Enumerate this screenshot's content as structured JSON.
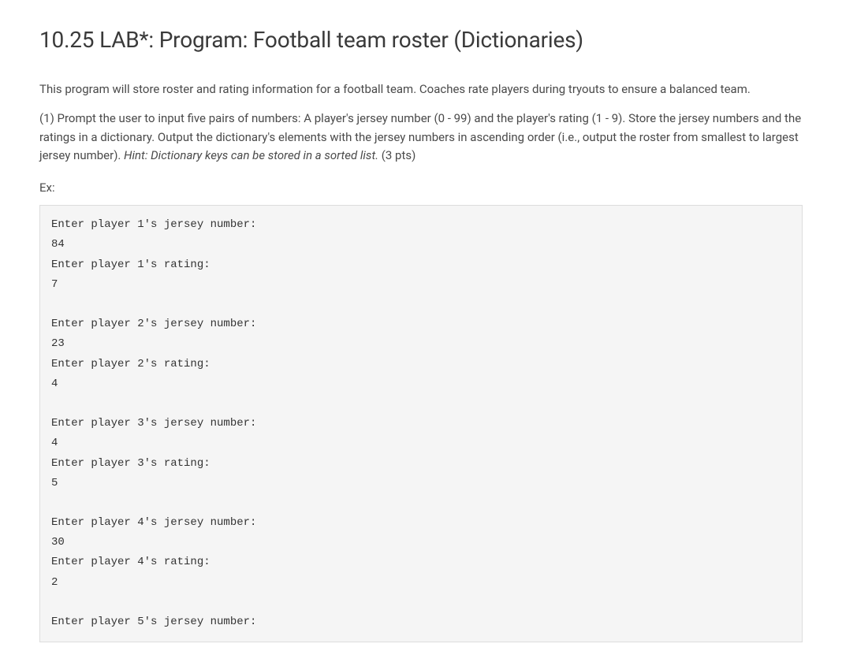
{
  "title": "10.25 LAB*: Program: Football team roster (Dictionaries)",
  "intro": "This program will store roster and rating information for a football team. Coaches rate players during tryouts to ensure a balanced team.",
  "step1_prefix": "(1) Prompt the user to input five pairs of numbers: A player's jersey number (0 - 99) and the player's rating (1 - 9). Store the jersey numbers and the ratings in a dictionary. Output the dictionary's elements with the jersey numbers in ascending order (i.e., output the roster from smallest to largest jersey number). ",
  "hint": "Hint: Dictionary keys can be stored in a sorted list.",
  "points": " (3 pts)",
  "example_label": "Ex:",
  "code": "Enter player 1's jersey number:\n84\nEnter player 1's rating:\n7\n\nEnter player 2's jersey number:\n23\nEnter player 2's rating:\n4\n\nEnter player 3's jersey number:\n4\nEnter player 3's rating:\n5\n\nEnter player 4's jersey number:\n30\nEnter player 4's rating:\n2\n\nEnter player 5's jersey number:"
}
